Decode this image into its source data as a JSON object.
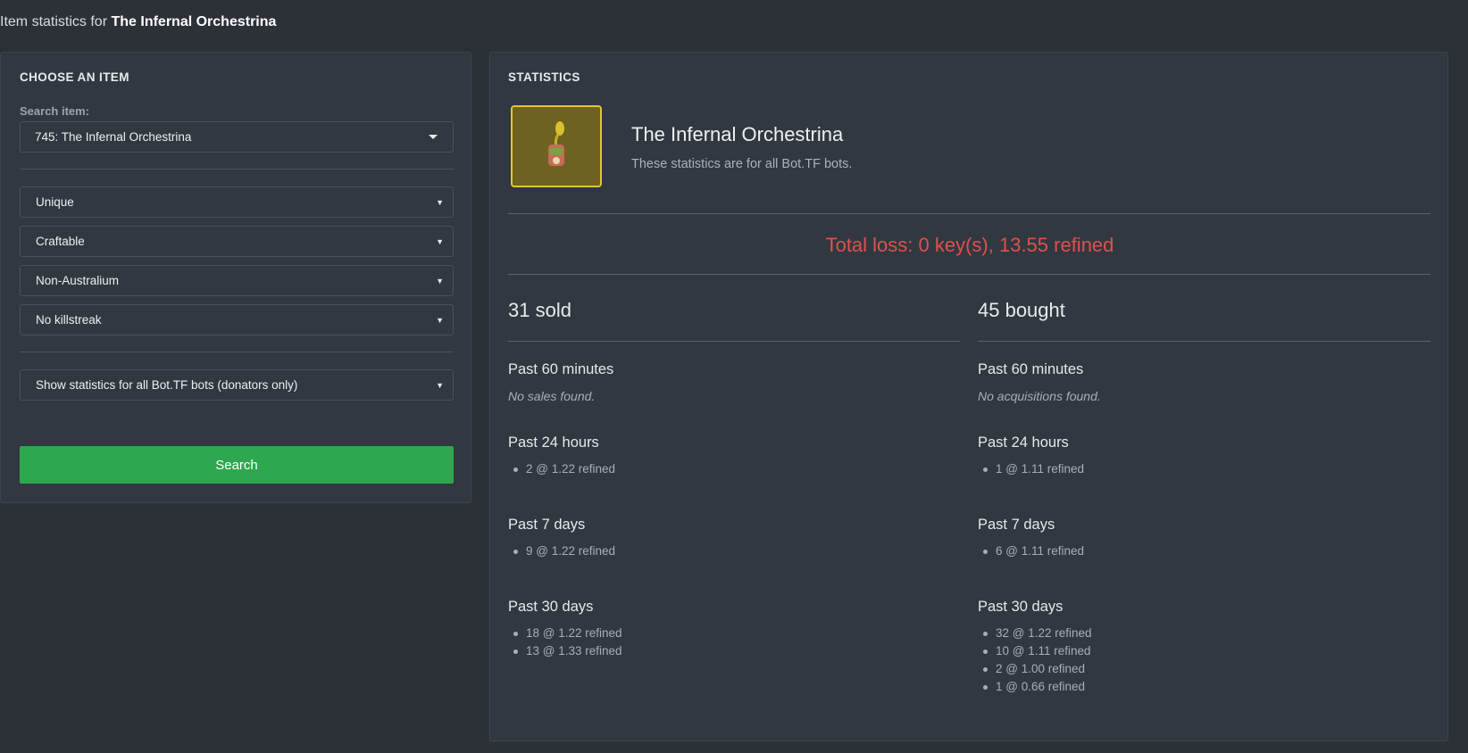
{
  "header": {
    "prefix": "Item statistics for",
    "item_name": "The Infernal Orchestrina"
  },
  "chooser": {
    "title": "CHOOSE AN ITEM",
    "search_label": "Search item:",
    "search_value": "745: The Infernal Orchestrina",
    "quality": "Unique",
    "craftable": "Craftable",
    "australium": "Non-Australium",
    "killstreak": "No killstreak",
    "scope": "Show statistics for all Bot.TF bots (donators only)",
    "search_button": "Search"
  },
  "statistics": {
    "title": "STATISTICS",
    "item_name": "The Infernal Orchestrina",
    "subtitle": "These statistics are for all Bot.TF bots.",
    "total_loss": "Total loss: 0 key(s), 13.55 refined",
    "item_border_color": "#e0c828",
    "item_bg_color": "#6e6220"
  },
  "sold": {
    "heading": "31 sold",
    "p60_label": "Past 60 minutes",
    "p60_empty": "No sales found.",
    "p24_label": "Past 24 hours",
    "p24": [
      "2 @ 1.22 refined"
    ],
    "p7_label": "Past 7 days",
    "p7": [
      "9 @ 1.22 refined"
    ],
    "p30_label": "Past 30 days",
    "p30": [
      "18 @ 1.22 refined",
      "13 @ 1.33 refined"
    ]
  },
  "bought": {
    "heading": "45 bought",
    "p60_label": "Past 60 minutes",
    "p60_empty": "No acquisitions found.",
    "p24_label": "Past 24 hours",
    "p24": [
      "1 @ 1.11 refined"
    ],
    "p7_label": "Past 7 days",
    "p7": [
      "6 @ 1.11 refined"
    ],
    "p30_label": "Past 30 days",
    "p30": [
      "32 @ 1.22 refined",
      "10 @ 1.11 refined",
      "2 @ 1.00 refined",
      "1 @ 0.66 refined"
    ]
  }
}
